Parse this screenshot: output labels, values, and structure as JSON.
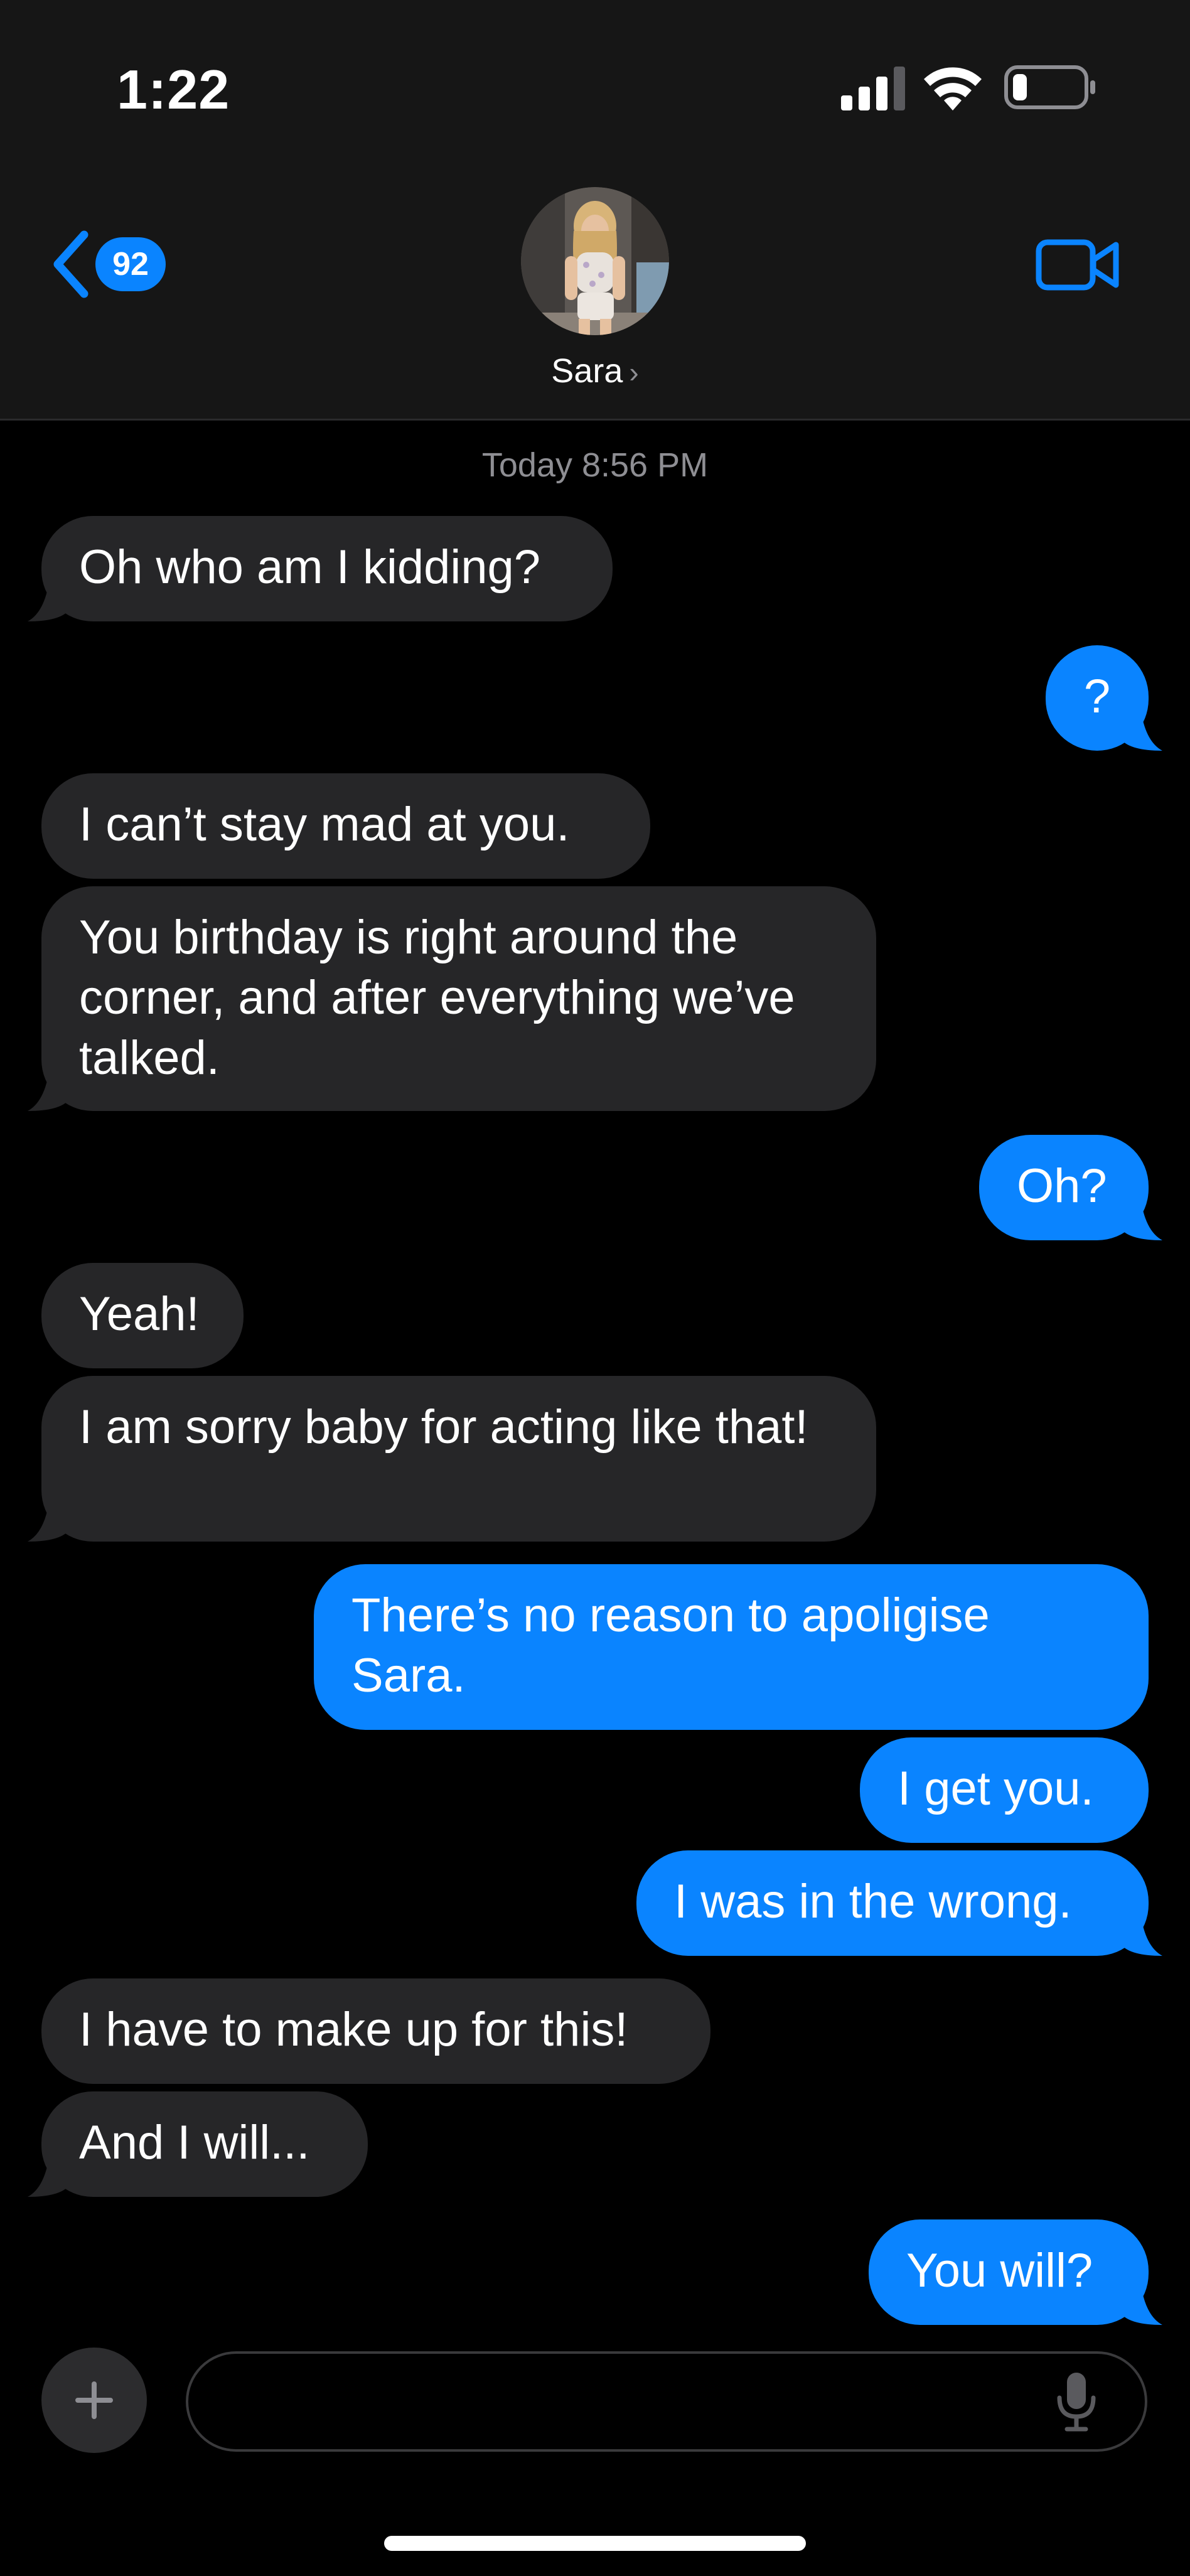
{
  "status_bar": {
    "time": "1:22",
    "icons": [
      "cellular-signal-icon",
      "wifi-icon",
      "battery-icon"
    ]
  },
  "header": {
    "back_badge": "92",
    "contact_name": "Sara",
    "name_chevron": "›",
    "icons": [
      "back-chevron-icon",
      "video-call-icon"
    ]
  },
  "conversation": {
    "timestamp": "Today 8:56 PM",
    "messages": [
      {
        "from": "contact",
        "text": "Oh who am I kidding?"
      },
      {
        "from": "me",
        "text": "?"
      },
      {
        "from": "contact",
        "text": "I can’t stay mad at you."
      },
      {
        "from": "contact",
        "text": "You birthday is right around the corner, and after everything we’ve talked."
      },
      {
        "from": "me",
        "text": "Oh?"
      },
      {
        "from": "contact",
        "text": "Yeah!"
      },
      {
        "from": "contact",
        "text": "I am sorry baby for acting like that!"
      },
      {
        "from": "me",
        "text": "There’s no reason to apoligise Sara."
      },
      {
        "from": "me",
        "text": "I get you."
      },
      {
        "from": "me",
        "text": "I was in the wrong."
      },
      {
        "from": "contact",
        "text": "I have to make up for this!"
      },
      {
        "from": "contact",
        "text": "And I will..."
      },
      {
        "from": "me",
        "text": "You will?"
      }
    ]
  },
  "composer": {
    "value": "",
    "placeholder": "",
    "icons": [
      "plus-icon",
      "microphone-icon"
    ]
  },
  "colors": {
    "outgoing_bubble": "#0a84ff",
    "incoming_bubble": "#262628",
    "accent": "#0a84ff",
    "header_background": "#161616"
  }
}
